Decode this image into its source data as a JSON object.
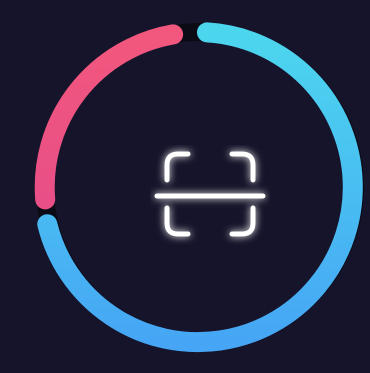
{
  "scanner": {
    "icon": "scan-frame-icon",
    "colors": {
      "background": "#15142a",
      "ring_track": "#0b0b16",
      "ring_pink": "#f2577d",
      "ring_cyan": "#4cd6ee",
      "ring_blue": "#46a6f5",
      "icon_stroke": "#ffffff",
      "icon_glow": "#b9b4ff"
    },
    "progress_segments": [
      {
        "name": "pink",
        "fraction": 0.16
      },
      {
        "name": "cyan-blue",
        "fraction": 0.78
      }
    ]
  }
}
